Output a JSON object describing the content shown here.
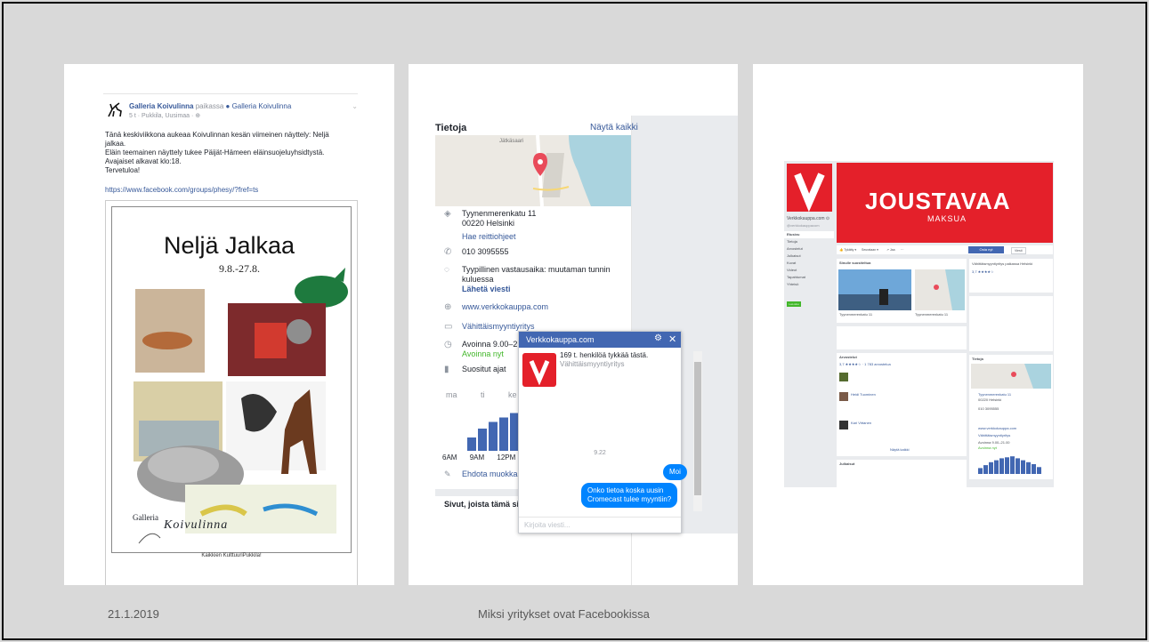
{
  "panel1": {
    "page_name": "Galleria Koivulinna",
    "in_place": "paikassa",
    "place": "Galleria Koivulinna",
    "meta": "5 t · Pukkila, Uusimaa · ⊕",
    "text_lines": [
      "Tänä keskiviikkona aukeaa Koivulinnan kesän viimeinen näyttely: Neljä",
      "jalkaa.",
      "Eläin teemainen näyttely tukee Päijät-Hämeen eläinsuojeluyhsidtystä.",
      "Avajaiset alkavat klo:18.",
      "Tervetuloa!"
    ],
    "link": "https://www.facebook.com/groups/phesy/?fref=ts",
    "poster": {
      "title": "Neljä Jalkaa",
      "dates": "9.8.-27.8.",
      "galleria": "Galleria",
      "koivulinna": "Koivulinna",
      "caption": "Kaikkien KulttuuriPukkila!"
    }
  },
  "panel2": {
    "heading": "Tietoja",
    "show_all": "Näytä kaikki",
    "map_label": "Jätkäsaari",
    "address_line1": "Tyynenmerenkatu 11",
    "address_line2": "00220 Helsinki",
    "directions": "Hae reittiohjeet",
    "phone": "010 3095555",
    "response_line1": "Tyypillinen vastausaika: muutaman tunnin",
    "response_line2": "kuluessa",
    "send_message": "Lähetä viesti",
    "website": "www.verkkokauppa.com",
    "category": "Vähittäismyyntiyritys",
    "hours": "Avoinna 9.00–2",
    "open_now": "Avoinna nyt",
    "popular_times": "Suositut ajat",
    "days": [
      "ma",
      "ti",
      "ke"
    ],
    "hour_labels": [
      "6AM",
      "9AM",
      "12PM"
    ],
    "popular_bars": [
      0.3,
      0.5,
      0.65,
      0.75,
      0.85
    ],
    "suggest_edit": "Ehdota muokka",
    "pages_liked": "Sivut, joista tämä si",
    "messenger": {
      "title": "Verkkokauppa.com",
      "likes": "169 t. henkilöä tykkää tästä.",
      "category": "Vähittäismyyntiyritys",
      "time": "9.22",
      "msg1": "Moi",
      "msg2_line1": "Onko tietoa koska uusin",
      "msg2_line2": "Cromecast tulee myyntiin?",
      "placeholder": "Kirjoita viesti..."
    }
  },
  "panel3": {
    "cover_title": "JOUSTAVAA",
    "cover_sub": "MAKSUA",
    "logo_letter": "V",
    "page_name": "Verkkokauppa.com ⊙",
    "handle": "@verkkokauppacom",
    "nav": [
      "Etusivu",
      "Tietoja",
      "Arvostelut",
      "Julkaisut",
      "Kuvat",
      "Videot",
      "Tapahtumat",
      "Yhteisö"
    ],
    "green_btn": "Luo sivu",
    "actions": [
      "👍 Tykätty ▾",
      "Seurataan ▾",
      "↗ Jaa",
      "···"
    ],
    "shop_btn": "Osta nyt",
    "message_btn": "Viesti",
    "similar_heading": "Sinulle suositeltua",
    "store_heading": "Vähittäismyyntiyritys paikassa Helsinki",
    "rating": "3,7 ★★★★☆",
    "address_short": "Tyynenmerenkatu 11",
    "address_short2": "00220 Helsinki",
    "phone": "010 3095555",
    "website": "www.verkkokauppa.com",
    "category": "Vähittäismyyntiyritys",
    "hours": "Avoinna 9.00–21.00",
    "open_now": "Avoinna nyt",
    "reviews_heading": "Arvostelut",
    "reviews_count": "3,7 ★★★★☆ · 1 783 arvostelua",
    "post_heading": "Julkaisut",
    "about_heading": "Tietoja",
    "see_all": "Näytä kaikki",
    "reviewers": [
      "Heidi Tuominen",
      "Kari Virtanen"
    ]
  },
  "footer": {
    "date": "21.1.2019",
    "title": "Miksi yritykset ovat Facebookissa"
  },
  "colors": {
    "facebook_blue": "#4267b2",
    "link_blue": "#365899",
    "verkkokauppa_red": "#e4202a",
    "messenger_bubble": "#0084ff",
    "open_green": "#42b72a"
  }
}
